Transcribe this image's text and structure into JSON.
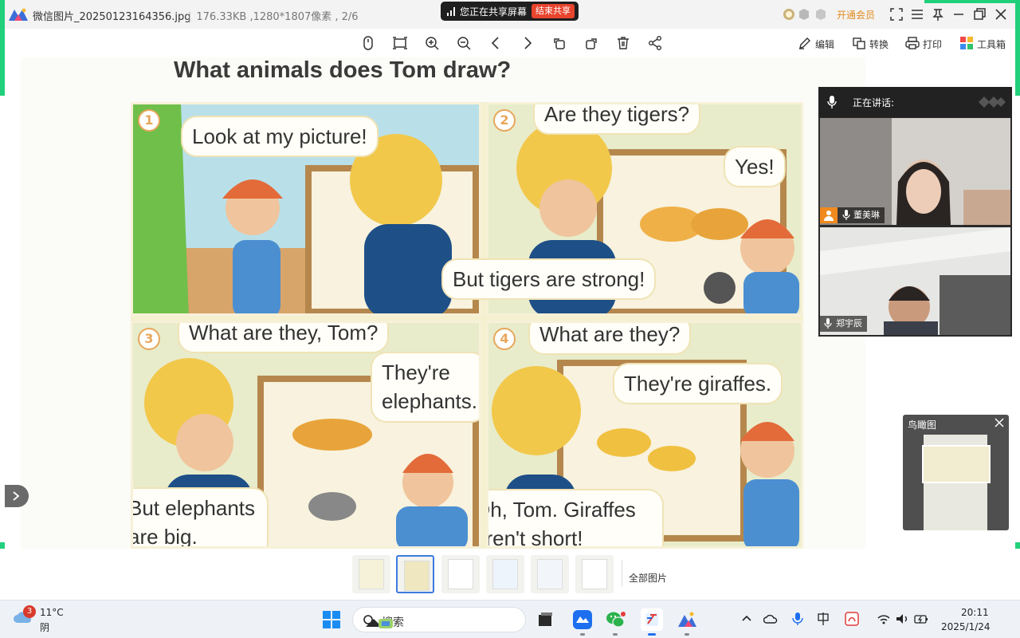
{
  "titlebar": {
    "file_name": "微信图片_20250123164356.jpg",
    "file_info": "176.33KB ,1280*1807像素 , 2/6",
    "share_status": "您正在共享屏幕",
    "share_stop": "结束共享",
    "vip_label": "开通会员"
  },
  "toolbar": {
    "edit_label": "编辑",
    "convert_label": "转换",
    "print_label": "打印",
    "toolbox_label": "工具箱"
  },
  "document": {
    "title": "What animals does Tom draw?",
    "panels": [
      {
        "number": "1",
        "bubbles": [
          "Look at my picture!"
        ]
      },
      {
        "number": "2",
        "bubbles": [
          "Are they tigers?",
          "Yes!",
          "But tigers are strong!"
        ]
      },
      {
        "number": "3",
        "bubbles": [
          "What are they, Tom?",
          "They're",
          "elephants.",
          "But elephants",
          "are big."
        ]
      },
      {
        "number": "4",
        "bubbles": [
          "What are they?",
          "They're giraffes.",
          "Oh, Tom. Giraffes",
          "aren't short!"
        ]
      }
    ]
  },
  "call": {
    "speaking_label": "正在讲话:",
    "participants": [
      {
        "name": "董美琳"
      },
      {
        "name": "郑宇辰"
      }
    ]
  },
  "minimap": {
    "title": "鸟瞰图"
  },
  "thumbnails": {
    "all_label": "全部图片",
    "count": 6,
    "active_index": 1
  },
  "taskbar": {
    "weather_badge": "3",
    "weather_temp": "11°C",
    "weather_cond": "阴",
    "search_placeholder": "搜索",
    "time": "20:11",
    "date": "2025/1/24"
  },
  "colors": {
    "share_frame": "#21d07a",
    "stop_button": "#e8442e",
    "vip": "#e38a1e",
    "active_thumb": "#3d7be0"
  }
}
